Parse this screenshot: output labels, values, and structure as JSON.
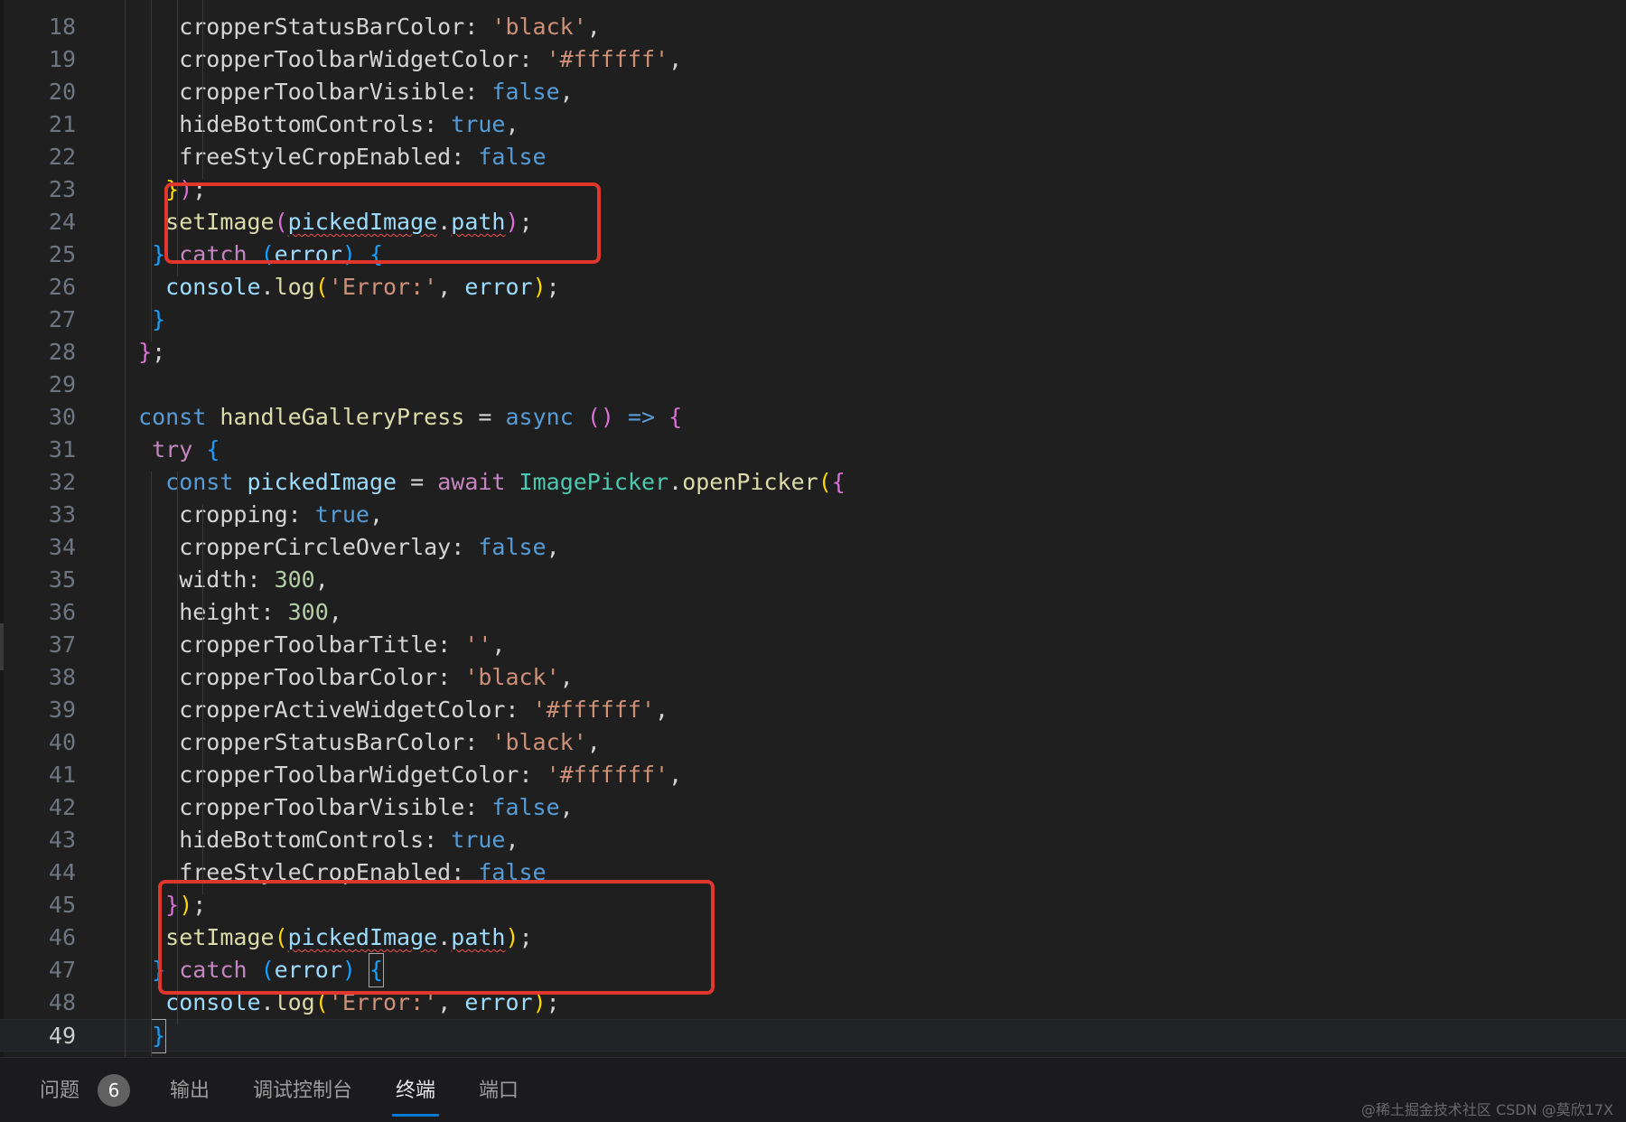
{
  "editor": {
    "lines": [
      {
        "n": "18",
        "parts": [
          [
            "",
            "    cropperStatusBarColor: "
          ],
          [
            "s",
            "'black'"
          ],
          [
            "",
            ","
          ]
        ]
      },
      {
        "n": "19",
        "parts": [
          [
            "",
            "    cropperToolbarWidgetColor: "
          ],
          [
            "s",
            "'#ffffff'"
          ],
          [
            "",
            ","
          ]
        ]
      },
      {
        "n": "20",
        "parts": [
          [
            "",
            "    cropperToolbarVisible: "
          ],
          [
            "k",
            "false"
          ],
          [
            "",
            ","
          ]
        ]
      },
      {
        "n": "21",
        "parts": [
          [
            "",
            "    hideBottomControls: "
          ],
          [
            "k",
            "true"
          ],
          [
            "",
            ","
          ]
        ]
      },
      {
        "n": "22",
        "parts": [
          [
            "",
            "    freeStyleCropEnabled: "
          ],
          [
            "k",
            "false"
          ]
        ]
      },
      {
        "n": "23",
        "parts": [
          [
            "",
            "   "
          ],
          [
            "b3",
            "}"
          ],
          [
            "b1",
            ")"
          ],
          [
            "",
            ";"
          ]
        ]
      },
      {
        "n": "24",
        "parts": [
          [
            "",
            "   "
          ],
          [
            "f",
            "setImage"
          ],
          [
            "b1",
            "("
          ],
          [
            "p sq",
            "pickedImage"
          ],
          [
            "",
            "."
          ],
          [
            "p sq",
            "path"
          ],
          [
            "b1",
            ")"
          ],
          [
            "",
            ";"
          ]
        ]
      },
      {
        "n": "25",
        "parts": [
          [
            "",
            "  "
          ],
          [
            "b2",
            "}"
          ],
          [
            "",
            " "
          ],
          [
            "kw",
            "catch"
          ],
          [
            "",
            " "
          ],
          [
            "b2",
            "("
          ],
          [
            "p",
            "error"
          ],
          [
            "b2",
            ")"
          ],
          [
            "",
            " "
          ],
          [
            "b2",
            "{"
          ]
        ]
      },
      {
        "n": "26",
        "parts": [
          [
            "",
            "   "
          ],
          [
            "p",
            "console"
          ],
          [
            "",
            "."
          ],
          [
            "f",
            "log"
          ],
          [
            "b3",
            "("
          ],
          [
            "s",
            "'Error:'"
          ],
          [
            "",
            ", "
          ],
          [
            "p",
            "error"
          ],
          [
            "b3",
            ")"
          ],
          [
            "",
            ";"
          ]
        ]
      },
      {
        "n": "27",
        "parts": [
          [
            "",
            "  "
          ],
          [
            "b2",
            "}"
          ]
        ]
      },
      {
        "n": "28",
        "parts": [
          [
            "",
            " "
          ],
          [
            "b1",
            "}"
          ],
          [
            "",
            ";"
          ]
        ]
      },
      {
        "n": "29",
        "parts": []
      },
      {
        "n": "30",
        "parts": [
          [
            "",
            " "
          ],
          [
            "k",
            "const"
          ],
          [
            "",
            " "
          ],
          [
            "f",
            "handleGalleryPress"
          ],
          [
            "",
            " = "
          ],
          [
            "k",
            "async"
          ],
          [
            "",
            " "
          ],
          [
            "b1",
            "()"
          ],
          [
            "",
            " "
          ],
          [
            "k",
            "=>"
          ],
          [
            "",
            " "
          ],
          [
            "b1",
            "{"
          ]
        ]
      },
      {
        "n": "31",
        "parts": [
          [
            "",
            "  "
          ],
          [
            "kw",
            "try"
          ],
          [
            "",
            " "
          ],
          [
            "b2",
            "{"
          ]
        ]
      },
      {
        "n": "32",
        "parts": [
          [
            "",
            "   "
          ],
          [
            "k",
            "const"
          ],
          [
            "",
            " "
          ],
          [
            "p",
            "pickedImage"
          ],
          [
            "",
            " = "
          ],
          [
            "kw",
            "await"
          ],
          [
            "",
            " "
          ],
          [
            "t",
            "ImagePicker"
          ],
          [
            "",
            "."
          ],
          [
            "f",
            "openPicker"
          ],
          [
            "b3",
            "("
          ],
          [
            "b1",
            "{"
          ]
        ]
      },
      {
        "n": "33",
        "parts": [
          [
            "",
            "    cropping: "
          ],
          [
            "k",
            "true"
          ],
          [
            "",
            ","
          ]
        ]
      },
      {
        "n": "34",
        "parts": [
          [
            "",
            "    cropperCircleOverlay: "
          ],
          [
            "k",
            "false"
          ],
          [
            "",
            ","
          ]
        ]
      },
      {
        "n": "35",
        "parts": [
          [
            "",
            "    width: "
          ],
          [
            "n",
            "300"
          ],
          [
            "",
            ","
          ]
        ]
      },
      {
        "n": "36",
        "parts": [
          [
            "",
            "    height: "
          ],
          [
            "n",
            "300"
          ],
          [
            "",
            ","
          ]
        ]
      },
      {
        "n": "37",
        "parts": [
          [
            "",
            "    cropperToolbarTitle: "
          ],
          [
            "s",
            "''"
          ],
          [
            "",
            ","
          ]
        ]
      },
      {
        "n": "38",
        "parts": [
          [
            "",
            "    cropperToolbarColor: "
          ],
          [
            "s",
            "'black'"
          ],
          [
            "",
            ","
          ]
        ]
      },
      {
        "n": "39",
        "parts": [
          [
            "",
            "    cropperActiveWidgetColor: "
          ],
          [
            "s",
            "'#ffffff'"
          ],
          [
            "",
            ","
          ]
        ]
      },
      {
        "n": "40",
        "parts": [
          [
            "",
            "    cropperStatusBarColor: "
          ],
          [
            "s",
            "'black'"
          ],
          [
            "",
            ","
          ]
        ]
      },
      {
        "n": "41",
        "parts": [
          [
            "",
            "    cropperToolbarWidgetColor: "
          ],
          [
            "s",
            "'#ffffff'"
          ],
          [
            "",
            ","
          ]
        ]
      },
      {
        "n": "42",
        "parts": [
          [
            "",
            "    cropperToolbarVisible: "
          ],
          [
            "k",
            "false"
          ],
          [
            "",
            ","
          ]
        ]
      },
      {
        "n": "43",
        "parts": [
          [
            "",
            "    hideBottomControls: "
          ],
          [
            "k",
            "true"
          ],
          [
            "",
            ","
          ]
        ]
      },
      {
        "n": "44",
        "parts": [
          [
            "",
            "    freeStyleCropEnabled: "
          ],
          [
            "k",
            "false"
          ]
        ]
      },
      {
        "n": "45",
        "parts": [
          [
            "",
            "   "
          ],
          [
            "b1",
            "}"
          ],
          [
            "b3",
            ")"
          ],
          [
            "",
            ";"
          ]
        ]
      },
      {
        "n": "46",
        "parts": [
          [
            "",
            "   "
          ],
          [
            "f",
            "setImage"
          ],
          [
            "b3",
            "("
          ],
          [
            "p sq",
            "pickedImage"
          ],
          [
            "",
            "."
          ],
          [
            "p sq",
            "path"
          ],
          [
            "b3",
            ")"
          ],
          [
            "",
            ";"
          ]
        ]
      },
      {
        "n": "47",
        "parts": [
          [
            "",
            "  "
          ],
          [
            "b2",
            "}"
          ],
          [
            "",
            " "
          ],
          [
            "kw",
            "catch"
          ],
          [
            "",
            " "
          ],
          [
            "b2",
            "("
          ],
          [
            "p",
            "error"
          ],
          [
            "b2",
            ")"
          ],
          [
            "",
            " "
          ],
          [
            "b2 cursor",
            "{"
          ]
        ]
      },
      {
        "n": "48",
        "parts": [
          [
            "",
            "   "
          ],
          [
            "p",
            "console"
          ],
          [
            "",
            "."
          ],
          [
            "f",
            "log"
          ],
          [
            "b3",
            "("
          ],
          [
            "s",
            "'Error:'"
          ],
          [
            "",
            ", "
          ],
          [
            "p",
            "error"
          ],
          [
            "b3",
            ")"
          ],
          [
            "",
            ";"
          ]
        ]
      },
      {
        "n": "49",
        "parts": [
          [
            "",
            "  "
          ],
          [
            "b2 cursor",
            "}"
          ]
        ],
        "current": true
      }
    ]
  },
  "panel": {
    "tabs": [
      {
        "label": "问题",
        "name": "tab-problems"
      },
      {
        "label": "输出",
        "name": "tab-output"
      },
      {
        "label": "调试控制台",
        "name": "tab-debug-console"
      },
      {
        "label": "终端",
        "name": "tab-terminal",
        "active": true
      },
      {
        "label": "端口",
        "name": "tab-ports"
      }
    ],
    "problems_count": "6",
    "watermark": "@稀土掘金技术社区 CSDN @莫欣17X"
  },
  "colors": {
    "highlight_box": "#e0362b",
    "active_tab_underline": "#0078d4"
  }
}
